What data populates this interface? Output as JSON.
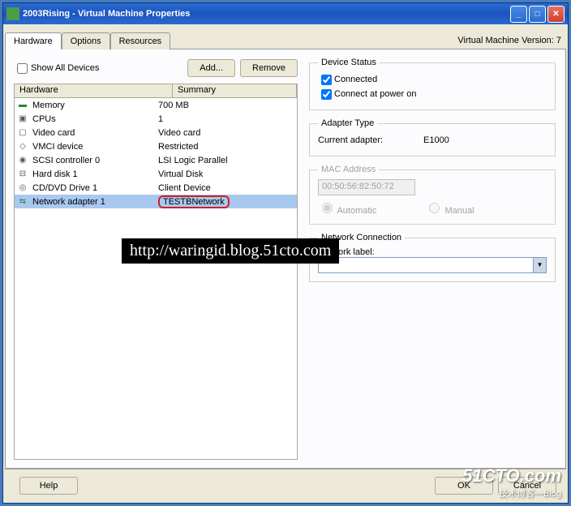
{
  "window": {
    "title": "2003Rising - Virtual Machine Properties"
  },
  "version_label": "Virtual Machine Version: 7",
  "tabs": {
    "t0": "Hardware",
    "t1": "Options",
    "t2": "Resources"
  },
  "opt": {
    "show_all": "Show All Devices",
    "add": "Add...",
    "remove": "Remove"
  },
  "cols": {
    "hw": "Hardware",
    "sum": "Summary"
  },
  "rows": [
    {
      "icon": "▬",
      "name": "Memory",
      "sum": "700 MB"
    },
    {
      "icon": "▣",
      "name": "CPUs",
      "sum": "1"
    },
    {
      "icon": "▢",
      "name": "Video card",
      "sum": "Video card"
    },
    {
      "icon": "◇",
      "name": "VMCI device",
      "sum": "Restricted"
    },
    {
      "icon": "◉",
      "name": "SCSI controller 0",
      "sum": "LSI Logic Parallel"
    },
    {
      "icon": "⊟",
      "name": "Hard disk 1",
      "sum": "Virtual Disk"
    },
    {
      "icon": "◎",
      "name": "CD/DVD Drive 1",
      "sum": "Client Device"
    },
    {
      "icon": "⇆",
      "name": "Network adapter 1",
      "sum": "TESTBNetwork"
    }
  ],
  "device_status": {
    "legend": "Device Status",
    "connected": "Connected",
    "power_on": "Connect at power on"
  },
  "adapter": {
    "legend": "Adapter Type",
    "label": "Current adapter:",
    "value": "E1000"
  },
  "mac": {
    "legend": "MAC Address",
    "value": "00:50:56:82:50:72",
    "auto": "Automatic",
    "manual": "Manual"
  },
  "net": {
    "legend": "Network Connection",
    "label": "Network label:"
  },
  "buttons": {
    "help": "Help",
    "ok": "OK",
    "cancel": "Cancel"
  },
  "watermark": "http://waringid.blog.51cto.com",
  "logo": {
    "big": "51CTO.com",
    "sm": "技术博客—Blog"
  }
}
